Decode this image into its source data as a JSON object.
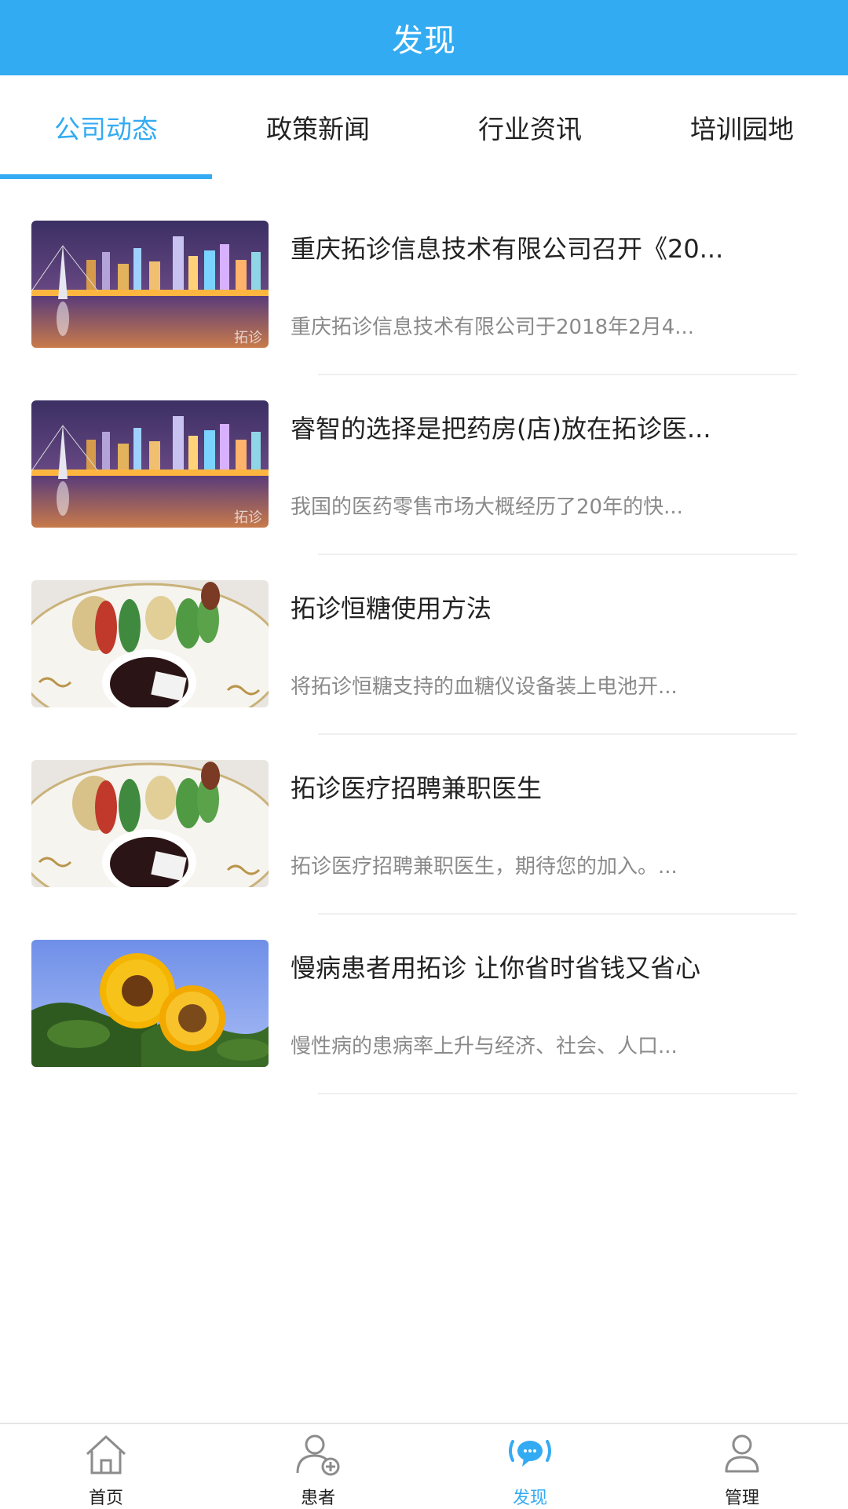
{
  "header": {
    "title": "发现"
  },
  "tabs": [
    {
      "label": "公司动态",
      "active": true
    },
    {
      "label": "政策新闻",
      "active": false
    },
    {
      "label": "行业资讯",
      "active": false
    },
    {
      "label": "培训园地",
      "active": false
    }
  ],
  "articles": [
    {
      "title": "重庆拓诊信息技术有限公司召开《20...",
      "summary": "重庆拓诊信息技术有限公司于2018年2月4...",
      "image": "city-night-photo",
      "watermark": "拓诊"
    },
    {
      "title": "睿智的选择是把药房(店)放在拓诊医...",
      "summary": "我国的医药零售市场大概经历了20年的快...",
      "image": "city-night-photo",
      "watermark": "拓诊"
    },
    {
      "title": "拓诊恒糖使用方法",
      "summary": "将拓诊恒糖支持的血糖仪设备装上电池开...",
      "image": "tempura-plate-photo"
    },
    {
      "title": "拓诊医疗招聘兼职医生",
      "summary": "拓诊医疗招聘兼职医生，期待您的加入。...",
      "image": "tempura-plate-photo"
    },
    {
      "title": "慢病患者用拓诊  让你省时省钱又省心",
      "summary": "慢性病的患病率上升与经济、社会、人口...",
      "image": "sunflower-photo"
    }
  ],
  "bottom_nav": [
    {
      "label": "首页",
      "icon": "home-icon",
      "active": false
    },
    {
      "label": "患者",
      "icon": "add-user-icon",
      "active": false
    },
    {
      "label": "发现",
      "icon": "chat-bubble-icon",
      "active": true
    },
    {
      "label": "管理",
      "icon": "user-icon",
      "active": false
    }
  ],
  "colors": {
    "accent": "#33abf2",
    "text": "#222222",
    "muted": "#8a8a8a"
  }
}
